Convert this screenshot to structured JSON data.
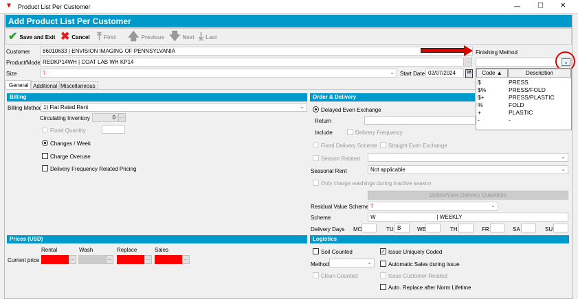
{
  "window": {
    "title": "Product List Per Customer",
    "minimize": "—",
    "maximize": "☐",
    "close": "✕"
  },
  "header": {
    "title": "Add Product List Per Customer"
  },
  "toolbar": {
    "save": "Save and Exit",
    "cancel": "Cancel",
    "first": "First",
    "previous": "Previous",
    "next": "Next",
    "last": "Last"
  },
  "form": {
    "customer_label": "Customer",
    "customer_value": "86010633      | ENVISION IMAGING OF PENNSYLVANIA",
    "product_label": "Product/Model",
    "product_value": "REDKP14WH     | COAT LAB WH KP14",
    "size_label": "Size",
    "size_value": "?",
    "start_date_label": "Start Date",
    "start_date_value": "02/07/2024",
    "calendar": "16",
    "finishing_label": "Finishing Method",
    "finishing_value": "",
    "ellipsis": "..."
  },
  "finishing_dropdown": {
    "col_code": "Code",
    "col_desc": "Description",
    "rows": [
      {
        "code": "$",
        "desc": "PRESS"
      },
      {
        "code": "$%",
        "desc": "PRESS/FOLD"
      },
      {
        "code": "$+",
        "desc": "PRESS/PLASTIC"
      },
      {
        "code": "%",
        "desc": "FOLD"
      },
      {
        "code": "+",
        "desc": "PLASTIC"
      },
      {
        "code": "-",
        "desc": "-"
      }
    ]
  },
  "tabs": [
    "General",
    "Additional",
    "Miscellaneous"
  ],
  "billing": {
    "title": "Billing",
    "method_label": "Billing Method",
    "method_value": "1) Flat Rated Rent",
    "circ_label": "Circulating Inventory",
    "circ_value": "0",
    "fixed_qty": "Fixed Quantity",
    "changes_week": "Changes / Week",
    "charge_overuse": "Charge Overuse",
    "delivery_freq_pricing": "Delivery Frequency Related Pricing"
  },
  "order": {
    "title": "Order & Delivery",
    "delayed": "Delayed Even Exchange",
    "return_label": "Return",
    "include_label": "Include",
    "delivery_frequency": "Delivery Frequency",
    "fixed_scheme": "Fixed Delivery Scheme",
    "straight": "Straight Even Exchange",
    "season_related": "Season Related",
    "seasonal_rent_label": "Seasonal Rent",
    "seasonal_rent_value": "Not applicable",
    "only_charge": "Only charge washings during inactive season",
    "define_button": "Define/View Delivery Quantities",
    "residual_label": "Residual Value Scheme",
    "residual_value": "?",
    "scheme_label": "Scheme",
    "scheme_value": "W                                        | WEEKLY",
    "delivery_days_label": "Delivery Days",
    "days": [
      {
        "d": "MO",
        "v": ""
      },
      {
        "d": "TU",
        "v": "B"
      },
      {
        "d": "WE",
        "v": ""
      },
      {
        "d": "TH",
        "v": ""
      },
      {
        "d": "FR",
        "v": ""
      },
      {
        "d": "SA",
        "v": ""
      },
      {
        "d": "SU",
        "v": ""
      }
    ]
  },
  "prices": {
    "title": "Prices (USD)",
    "rental": "Rental",
    "wash": "Wash",
    "replace": "Replace",
    "sales": "Sales",
    "current_price": "Current price"
  },
  "logistics": {
    "title": "Logistics",
    "soil_counted": "Soil Counted",
    "issue_uniquely": "Issue Uniquely Coded",
    "method_label": "Method",
    "auto_sales": "Automatic Sales during Issue",
    "clean_counted": "Clean Counted",
    "issue_customer": "Issue Customer Related",
    "auto_replace": "Auto. Replace after Norm Lifetime"
  },
  "colors": {
    "accent": "#0099cc",
    "required": "#ff0000",
    "annotation": "#e00000"
  }
}
